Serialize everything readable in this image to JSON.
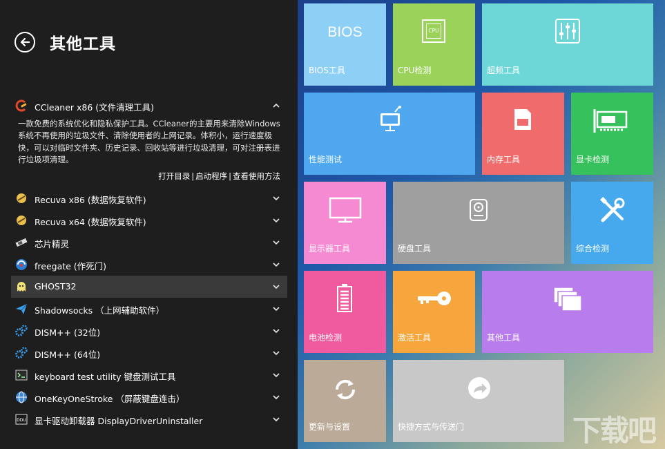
{
  "header": {
    "title": "其他工具"
  },
  "expanded_item": {
    "label": "CCleaner x86 (文件清理工具)",
    "description": "一款免费的系统优化和隐私保护工具。CCleaner的主要用来清除Windows系统不再使用的垃圾文件、清除使用者的上网记录。体积小，运行速度极快，可以对临时文件夹、历史记录、回收站等进行垃圾清理，可对注册表进行垃圾项清理。",
    "actions": [
      "打开目录",
      "启动程序",
      "查看使用方法"
    ]
  },
  "tools": [
    {
      "label": "Recuva x86 (数据恢复软件)",
      "icon": "recuva-icon"
    },
    {
      "label": "Recuva x64 (数据恢复软件)",
      "icon": "recuva-icon"
    },
    {
      "label": "芯片精灵",
      "icon": "chip-icon"
    },
    {
      "label": "freegate (作死门)",
      "icon": "freegate-icon"
    },
    {
      "label": "GHOST32",
      "icon": "ghost-icon",
      "selected": true
    },
    {
      "label": "Shadowsocks （上网辅助软件）",
      "icon": "paper-plane-icon"
    },
    {
      "label": "DISM++ (32位)",
      "icon": "gears-icon"
    },
    {
      "label": "DISM++ (64位)",
      "icon": "gears-icon"
    },
    {
      "label": "keyboard test utility 键盘测试工具",
      "icon": "terminal-icon"
    },
    {
      "label": "OneKeyOneStroke （屏蔽键盘连击）",
      "icon": "globe-icon"
    },
    {
      "label": "显卡驱动卸载器 DisplayDriverUninstaller",
      "icon": "ddu-icon"
    }
  ],
  "tiles": {
    "bios": {
      "label": "BIOS工具",
      "icon_text": "BIOS",
      "color": "#8ecff6"
    },
    "cpu": {
      "label": "CPU检测",
      "icon_text": "CPU",
      "color": "#9bd35a"
    },
    "overclock": {
      "label": "超频工具",
      "color": "#6dd6d6"
    },
    "perf": {
      "label": "性能测试",
      "color": "#4fa8ef"
    },
    "memory": {
      "label": "内存工具",
      "color": "#f06b6b"
    },
    "gpu": {
      "label": "显卡检测",
      "color": "#37c15c"
    },
    "monitor": {
      "label": "显示器工具",
      "color": "#f58ad2"
    },
    "disk": {
      "label": "硬盘工具",
      "color": "#9f9f9f"
    },
    "general": {
      "label": "综合检测",
      "color": "#46a9ee"
    },
    "battery": {
      "label": "电池检测",
      "color": "#f05ba0"
    },
    "activate": {
      "label": "激活工具",
      "color": "#f6a63c"
    },
    "other": {
      "label": "其他工具",
      "color": "#b97cec"
    },
    "update": {
      "label": "更新与设置",
      "color": "#bcaa98"
    },
    "shortcut": {
      "label": "快捷方式与传送门",
      "color": "#c8c8c8"
    }
  },
  "watermark": "下载吧"
}
